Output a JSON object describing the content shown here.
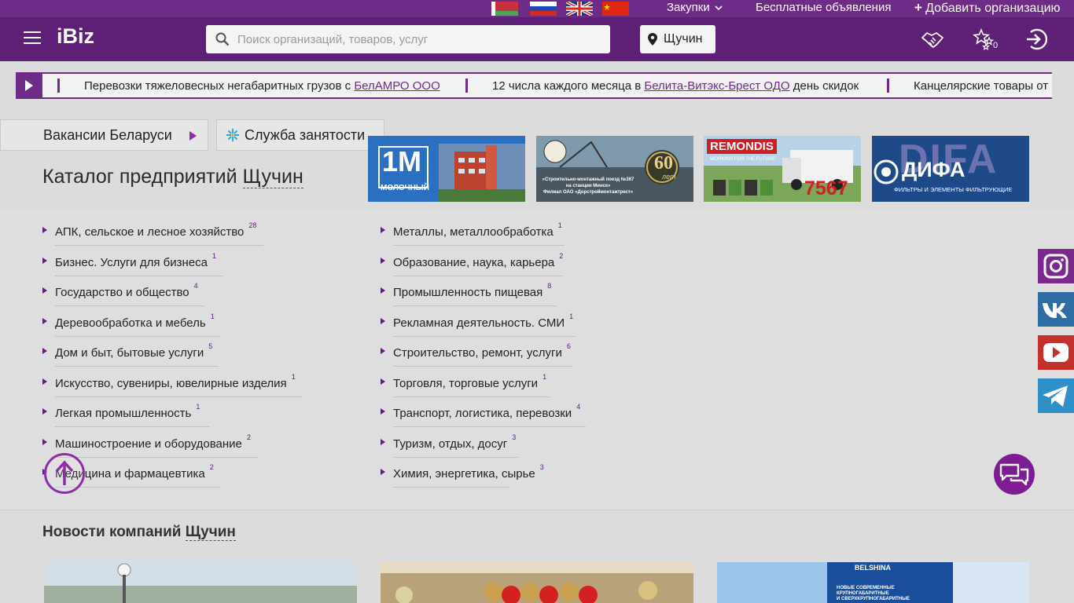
{
  "top_bar": {
    "flags": [
      "belarus-flag",
      "russia-flag",
      "uk-flag",
      "china-flag"
    ],
    "menu_zakupki": "Закупки",
    "menu_ads": "Бесплатные объявления",
    "menu_add_plus": "+",
    "menu_add": "Добавить организацию"
  },
  "header": {
    "logo": "iBiz",
    "search_placeholder": "Поиск организаций, товаров, услуг",
    "search_value": "",
    "city": "Щучин",
    "favorites_count": "0",
    "icons": [
      "handshake-icon",
      "stars-icon",
      "login-icon"
    ]
  },
  "ticker": {
    "items": [
      {
        "before": "Перевозки тяжеловесных негабаритных грузов с ",
        "link": "БелАМРО ООО",
        "after": ""
      },
      {
        "before": "12 числа каждого месяца в ",
        "link": "Белита-Витэкс-Брест ОДО",
        "after": " день скидок"
      },
      {
        "before": "Канцелярские товары от",
        "link": "",
        "after": ""
      }
    ]
  },
  "tabs": {
    "vacancies": "Вакансии Беларуси",
    "employment": "Служба занятости"
  },
  "catalog": {
    "title_prefix": "Каталог предприятий",
    "title_city": "Щучин",
    "left": [
      {
        "label": "АПК, сельское и лесное хозяйство",
        "count": "28"
      },
      {
        "label": "Бизнес. Услуги для бизнеса",
        "count": "1"
      },
      {
        "label": "Государство и общество",
        "count": "4"
      },
      {
        "label": "Деревообработка и мебель",
        "count": "1"
      },
      {
        "label": "Дом и быт, бытовые услуги",
        "count": "5"
      },
      {
        "label": "Искусство, сувениры, ювелирные изделия",
        "count": "1"
      },
      {
        "label": "Легкая промышленность",
        "count": "1"
      },
      {
        "label": "Машиностроение и оборудование",
        "count": "2"
      },
      {
        "label": "Медицина и фармацевтика",
        "count": "2"
      }
    ],
    "right": [
      {
        "label": "Металлы, металлообработка",
        "count": "1"
      },
      {
        "label": "Образование, наука, карьера",
        "count": "2"
      },
      {
        "label": "Промышленность пищевая",
        "count": "8"
      },
      {
        "label": "Рекламная деятельность. СМИ",
        "count": "1"
      },
      {
        "label": "Строительство, ремонт, услуги",
        "count": "6"
      },
      {
        "label": "Торговля, торговые услуги",
        "count": "1"
      },
      {
        "label": "Транспорт, логистика, перевозки",
        "count": "4"
      },
      {
        "label": "Туризм, отдых, досуг",
        "count": "3"
      },
      {
        "label": "Химия, энергетика, сырье",
        "count": "3"
      }
    ]
  },
  "banners": {
    "b1_logo": "1М",
    "b1_sub": "МОЛОЧНЫЙ",
    "b2_line1": "«Строительно-монтажный поезд №367",
    "b2_line2": "на станции Минск»",
    "b2_line3": "Филиал ОАО «Дорстроймонтажтрест»",
    "b2_badge": "60",
    "b2_years": "лет",
    "b3_logo": "REMONDIS",
    "b3_tag": "WORKING FOR THE FUTURE",
    "b3_phone": "7567",
    "b4_bg": "DIFA",
    "b4_logo": "ДИФА",
    "b4_sub": "ФИЛЬТРЫ И ЭЛЕМЕНТЫ ФИЛЬТРУЮЩИЕ"
  },
  "news": {
    "title_prefix": "Новости компаний",
    "title_city": "Щучин",
    "card3_brand": "BELSHINA",
    "card3_text1": "НОВЫЕ СОВРЕМЕННЫЕ",
    "card3_text2": "КРУПНОГАБАРИТНЫЕ",
    "card3_text3": "И СВЕРХКРУПНОГАБАРИТНЫЕ"
  },
  "social": [
    "instagram-icon",
    "vk-icon",
    "youtube-icon",
    "telegram-icon"
  ],
  "colors": {
    "brand_purple": "#5d2076",
    "top_strip": "#6f2b88",
    "accent_link": "#6f2b88"
  }
}
